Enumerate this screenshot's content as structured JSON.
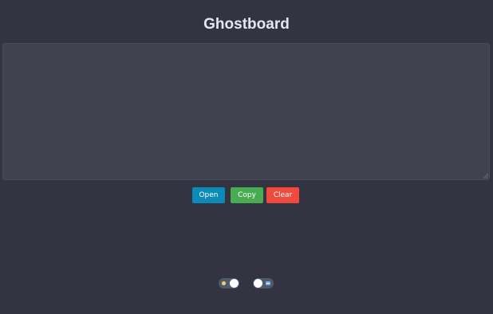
{
  "app": {
    "title": "Ghostboard"
  },
  "editor": {
    "value": "",
    "placeholder": ""
  },
  "buttons": {
    "open_label": "Open",
    "copy_label": "Copy",
    "clear_label": "Clear"
  },
  "toggles": {
    "theme": {
      "icon": "sun-icon",
      "on": true
    },
    "mode": {
      "icon": "keyboard-icon",
      "on": false
    }
  },
  "colors": {
    "background": "#343341",
    "editor_bg": "#42414e",
    "open": "#0a8bb8",
    "copy": "#4aac52",
    "clear": "#f04a3e"
  }
}
